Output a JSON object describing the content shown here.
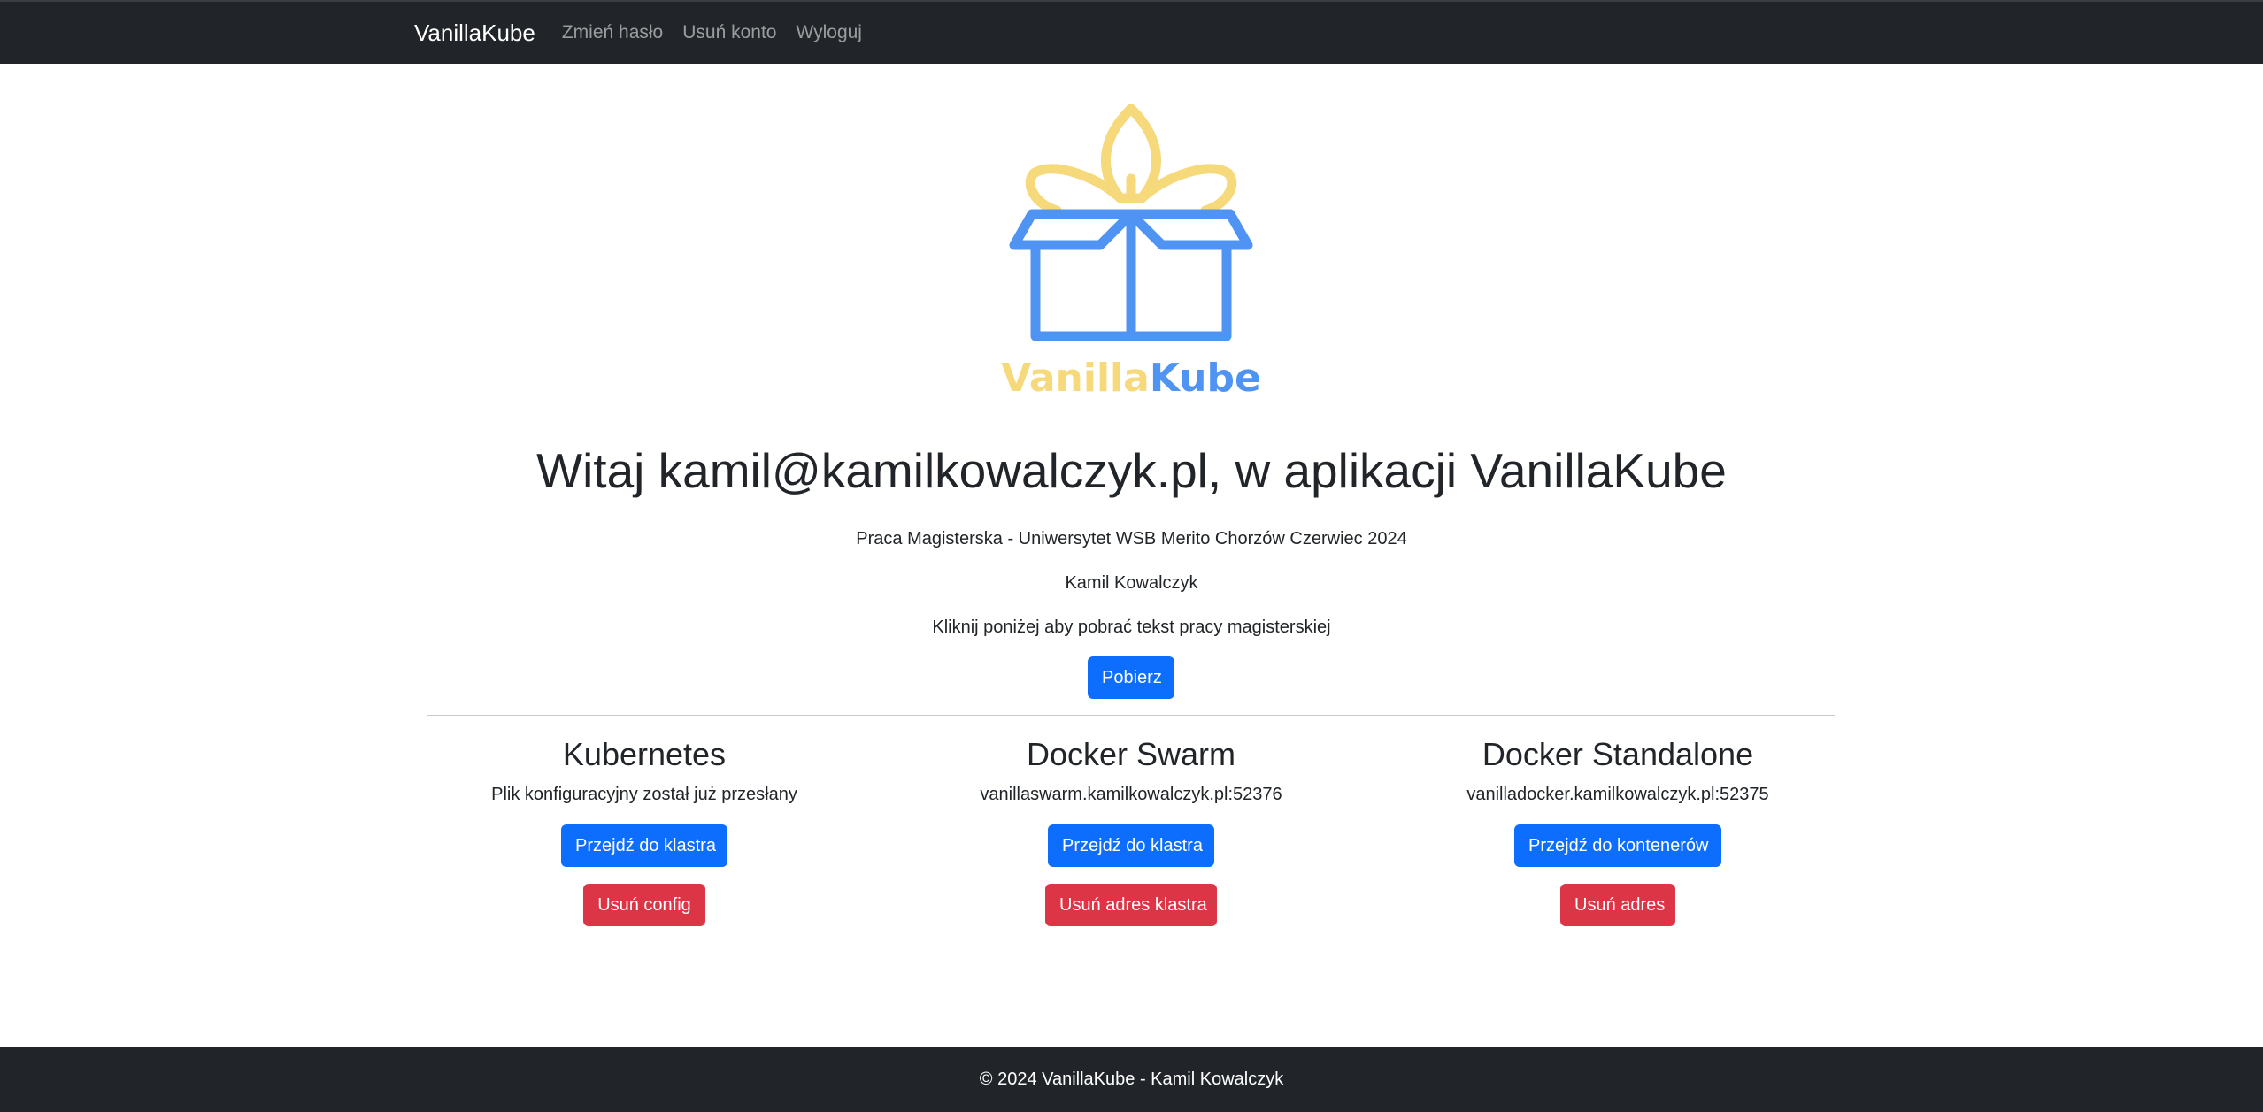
{
  "navbar": {
    "brand": "VanillaKube",
    "links": [
      "Zmień hasło",
      "Usuń konto",
      "Wyloguj"
    ]
  },
  "logo": {
    "word_part1": "Vanilla",
    "word_part2": "Kube",
    "color_yellow": "#f6d97a",
    "color_blue": "#4f94f2"
  },
  "hero": {
    "title": "Witaj kamil@kamilkowalczyk.pl, w aplikacji VanillaKube",
    "subtitle": "Praca Magisterska - Uniwersytet WSB Merito Chorzów Czerwiec 2024",
    "author": "Kamil Kowalczyk",
    "instruction": "Kliknij poniżej aby pobrać tekst pracy magisterskiej",
    "download_label": "Pobierz"
  },
  "sections": {
    "kubernetes": {
      "title": "Kubernetes",
      "status": "Plik konfiguracyjny został już przesłany",
      "primary_label": "Przejdź do klastra",
      "danger_label": "Usuń config"
    },
    "swarm": {
      "title": "Docker Swarm",
      "status": "vanillaswarm.kamilkowalczyk.pl:52376",
      "primary_label": "Przejdź do klastra",
      "danger_label": "Usuń adres klastra"
    },
    "standalone": {
      "title": "Docker Standalone",
      "status": "vanilladocker.kamilkowalczyk.pl:52375",
      "primary_label": "Przejdź do kontenerów",
      "danger_label": "Usuń adres"
    }
  },
  "footer": {
    "text": "© 2024 VanillaKube - Kamil Kowalczyk"
  },
  "colors": {
    "navbar_bg": "#212529",
    "primary": "#0d6efd",
    "danger": "#dc3545"
  }
}
